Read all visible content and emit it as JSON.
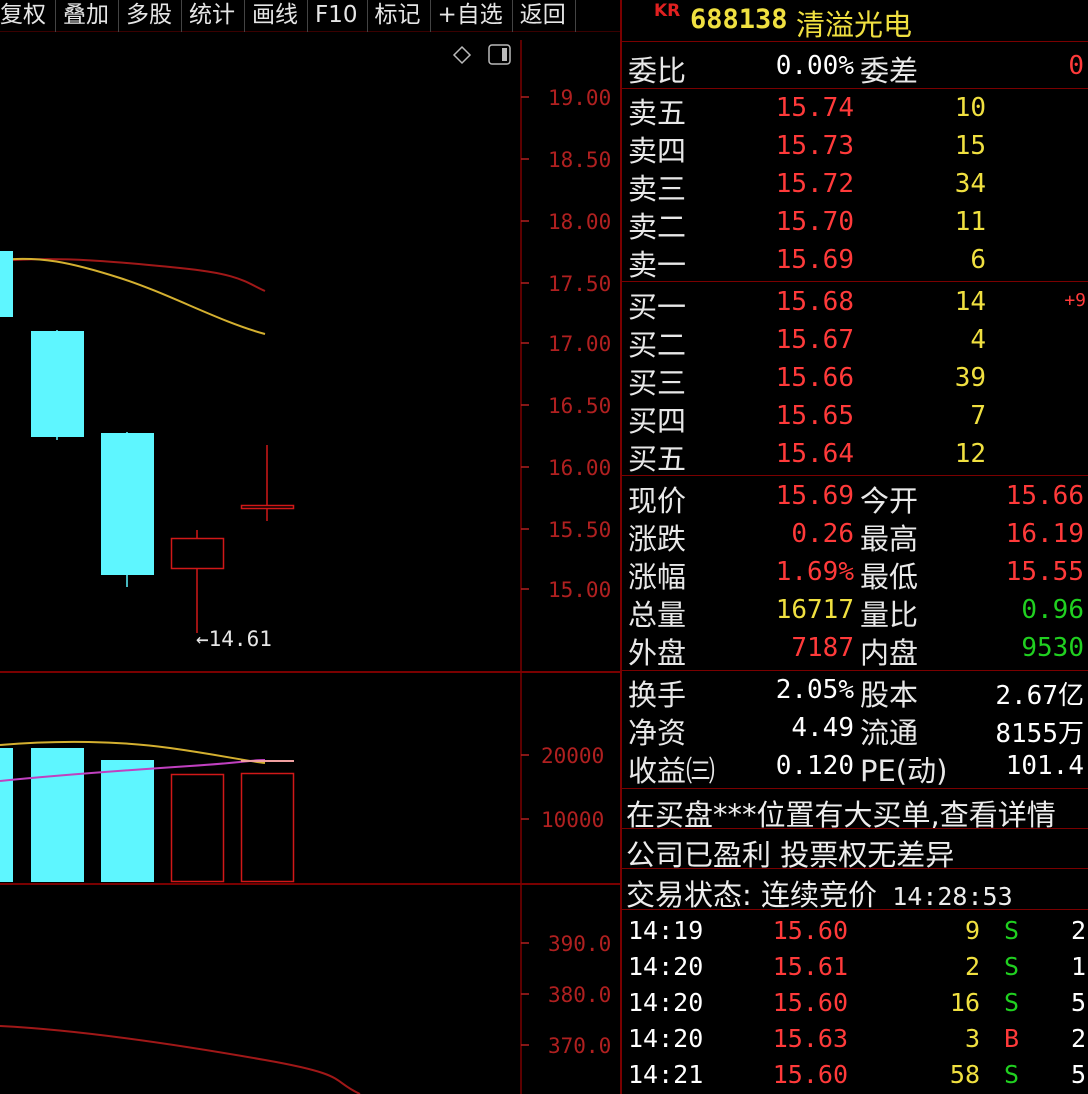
{
  "toolbar": [
    "复权",
    "叠加",
    "多股",
    "统计",
    "画线",
    "F10",
    "标记",
    "+自选",
    "返回"
  ],
  "chart": {
    "tool_icons": [
      "diamond-icon",
      "square-window-icon"
    ],
    "price_axis": [
      "19.00",
      "18.50",
      "18.00",
      "17.50",
      "17.00",
      "16.50",
      "16.00",
      "15.50",
      "15.00"
    ],
    "low_marker": "←14.61",
    "volume_axis": [
      "20000",
      "10000"
    ],
    "indicator_axis": [
      "390.0",
      "380.0",
      "370.0"
    ],
    "colors": {
      "down": "#5ef6ff",
      "up": "#d01818",
      "ma1": "#d4b030",
      "ma2": "#b01818"
    }
  },
  "stock": {
    "badge": "KR",
    "code": "688138",
    "name": "清溢光电"
  },
  "weibi": {
    "label": "委比",
    "value": "0.00%",
    "label2": "委差",
    "value2": "0"
  },
  "asks": [
    {
      "label": "卖五",
      "price": "15.74",
      "vol": "10"
    },
    {
      "label": "卖四",
      "price": "15.73",
      "vol": "15"
    },
    {
      "label": "卖三",
      "price": "15.72",
      "vol": "34"
    },
    {
      "label": "卖二",
      "price": "15.70",
      "vol": "11"
    },
    {
      "label": "卖一",
      "price": "15.69",
      "vol": "6"
    }
  ],
  "bids": [
    {
      "label": "买一",
      "price": "15.68",
      "vol": "14",
      "change": "+9"
    },
    {
      "label": "买二",
      "price": "15.67",
      "vol": "4",
      "change": ""
    },
    {
      "label": "买三",
      "price": "15.66",
      "vol": "39",
      "change": ""
    },
    {
      "label": "买四",
      "price": "15.65",
      "vol": "7",
      "change": ""
    },
    {
      "label": "买五",
      "price": "15.64",
      "vol": "12",
      "change": ""
    }
  ],
  "quote": [
    {
      "l1": "现价",
      "v1": "15.69",
      "c1": "red",
      "l2": "今开",
      "v2": "15.66",
      "c2": "red"
    },
    {
      "l1": "涨跌",
      "v1": "0.26",
      "c1": "red",
      "l2": "最高",
      "v2": "16.19",
      "c2": "red"
    },
    {
      "l1": "涨幅",
      "v1": "1.69%",
      "c1": "red",
      "l2": "最低",
      "v2": "15.55",
      "c2": "red"
    },
    {
      "l1": "总量",
      "v1": "16717",
      "c1": "yellow",
      "l2": "量比",
      "v2": "0.96",
      "c2": "green"
    },
    {
      "l1": "外盘",
      "v1": "7187",
      "c1": "red",
      "l2": "内盘",
      "v2": "9530",
      "c2": "green"
    }
  ],
  "fundamentals": [
    {
      "l1": "换手",
      "v1": "2.05%",
      "l2": "股本",
      "v2": "2.67亿"
    },
    {
      "l1": "净资",
      "v1": "4.49",
      "l2": "流通",
      "v2": "8155万"
    },
    {
      "l1": "收益㈢",
      "v1": "0.120",
      "l2": "PE(动)",
      "v2": "101.4"
    }
  ],
  "notices": [
    "在买盘***位置有大买单,查看详情",
    "公司已盈利 投票权无差异"
  ],
  "status": {
    "label": "交易状态: 连续竞价",
    "time": "14:28:53"
  },
  "ticks": [
    {
      "time": "14:19",
      "price": "15.60",
      "vol": "9",
      "side": "S",
      "n": "2"
    },
    {
      "time": "14:20",
      "price": "15.61",
      "vol": "2",
      "side": "S",
      "n": "1"
    },
    {
      "time": "14:20",
      "price": "15.60",
      "vol": "16",
      "side": "S",
      "n": "5"
    },
    {
      "time": "14:20",
      "price": "15.63",
      "vol": "3",
      "side": "B",
      "n": "2"
    },
    {
      "time": "14:21",
      "price": "15.60",
      "vol": "58",
      "side": "S",
      "n": "5"
    }
  ]
}
